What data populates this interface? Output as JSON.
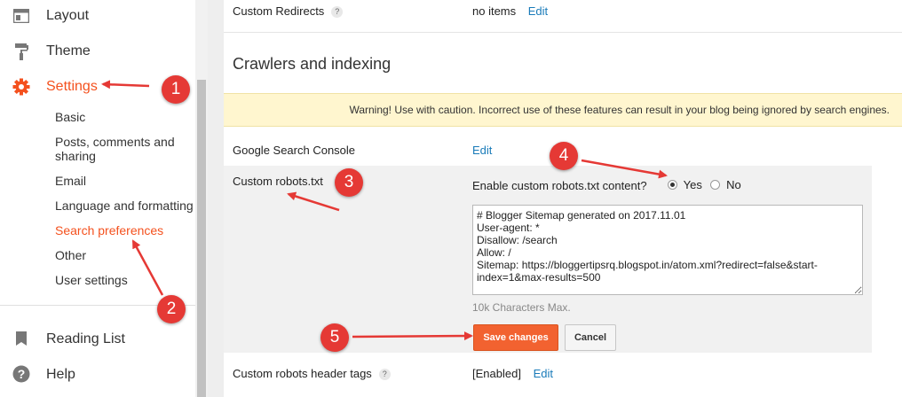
{
  "sidebar": {
    "nav": [
      {
        "label": "Layout",
        "icon": "layout-icon"
      },
      {
        "label": "Theme",
        "icon": "paint-roller-icon"
      },
      {
        "label": "Settings",
        "icon": "gear-icon",
        "active": true
      }
    ],
    "sub_items": [
      {
        "label": "Basic"
      },
      {
        "label": "Posts, comments and sharing"
      },
      {
        "label": "Email"
      },
      {
        "label": "Language and formatting"
      },
      {
        "label": "Search preferences",
        "active": true
      },
      {
        "label": "Other"
      },
      {
        "label": "User settings"
      }
    ],
    "bottom_nav": [
      {
        "label": "Reading List",
        "icon": "bookmark-icon"
      },
      {
        "label": "Help",
        "icon": "help-icon"
      }
    ]
  },
  "main": {
    "custom_redirects": {
      "label": "Custom Redirects",
      "help": "?",
      "value": "no items",
      "edit": "Edit"
    },
    "section_title": "Crawlers and indexing",
    "warning": "Warning! Use with caution. Incorrect use of these features can result in your blog being ignored by search engines.",
    "search_console": {
      "label": "Google Search Console",
      "edit": "Edit"
    },
    "custom_robots": {
      "label": "Custom robots.txt",
      "question": "Enable custom robots.txt content?",
      "yes": "Yes",
      "no": "No",
      "selected": "Yes",
      "content": "# Blogger Sitemap generated on 2017.11.01\nUser-agent: *\nDisallow: /search\nAllow: /\nSitemap: https://bloggertipsrq.blogspot.in/atom.xml?redirect=false&start-index=1&max-results=500",
      "char_limit": "10k Characters Max.",
      "save": "Save changes",
      "cancel": "Cancel"
    },
    "robots_header": {
      "label": "Custom robots header tags",
      "help": "?",
      "value": "[Enabled]",
      "edit": "Edit"
    }
  },
  "annotations": {
    "badges": [
      "1",
      "2",
      "3",
      "4",
      "5"
    ],
    "color": "#e53935"
  },
  "colors": {
    "accent": "#f4511e",
    "link": "#1a7bb9",
    "warning_bg": "#fff6cf",
    "save_button": "#f26230"
  }
}
